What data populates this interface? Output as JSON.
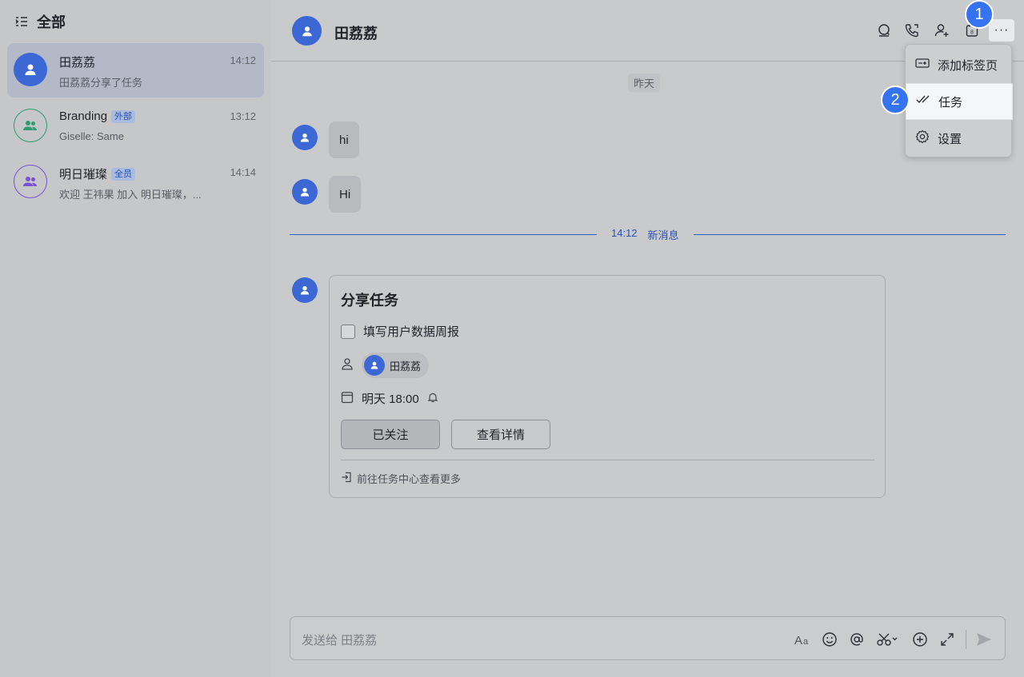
{
  "sidebar": {
    "title": "全部",
    "chats": [
      {
        "name": "田荔荔",
        "preview": "田荔荔分享了任务",
        "time": "14:12",
        "tag": ""
      },
      {
        "name": "Branding",
        "preview": "Giselle: Same",
        "time": "13:12",
        "tag": "外部"
      },
      {
        "name": "明日璀璨",
        "preview": "欢迎 王祎果 加入 明日璀璨，...",
        "time": "14:14",
        "tag": "全员"
      }
    ]
  },
  "chat": {
    "title": "田荔荔",
    "date_separator": "昨天",
    "messages": [
      "hi",
      "Hi"
    ],
    "new_time": "14:12",
    "new_label": "新消息"
  },
  "task_card": {
    "title": "分享任务",
    "task": "填写用户数据周报",
    "assignee": "田荔荔",
    "due": "明天 18:00",
    "follow_button": "已关注",
    "detail_button": "查看详情",
    "footer_link": "前往任务中心查看更多"
  },
  "composer": {
    "placeholder": "发送给 田荔荔"
  },
  "menu": {
    "items": [
      "添加标签页",
      "任务",
      "设置"
    ]
  },
  "badges": [
    "1",
    "2"
  ],
  "colors": {
    "accent": "#3573f3",
    "avatar_blue": "#3c68d6",
    "new_line": "#2f5fc8"
  }
}
